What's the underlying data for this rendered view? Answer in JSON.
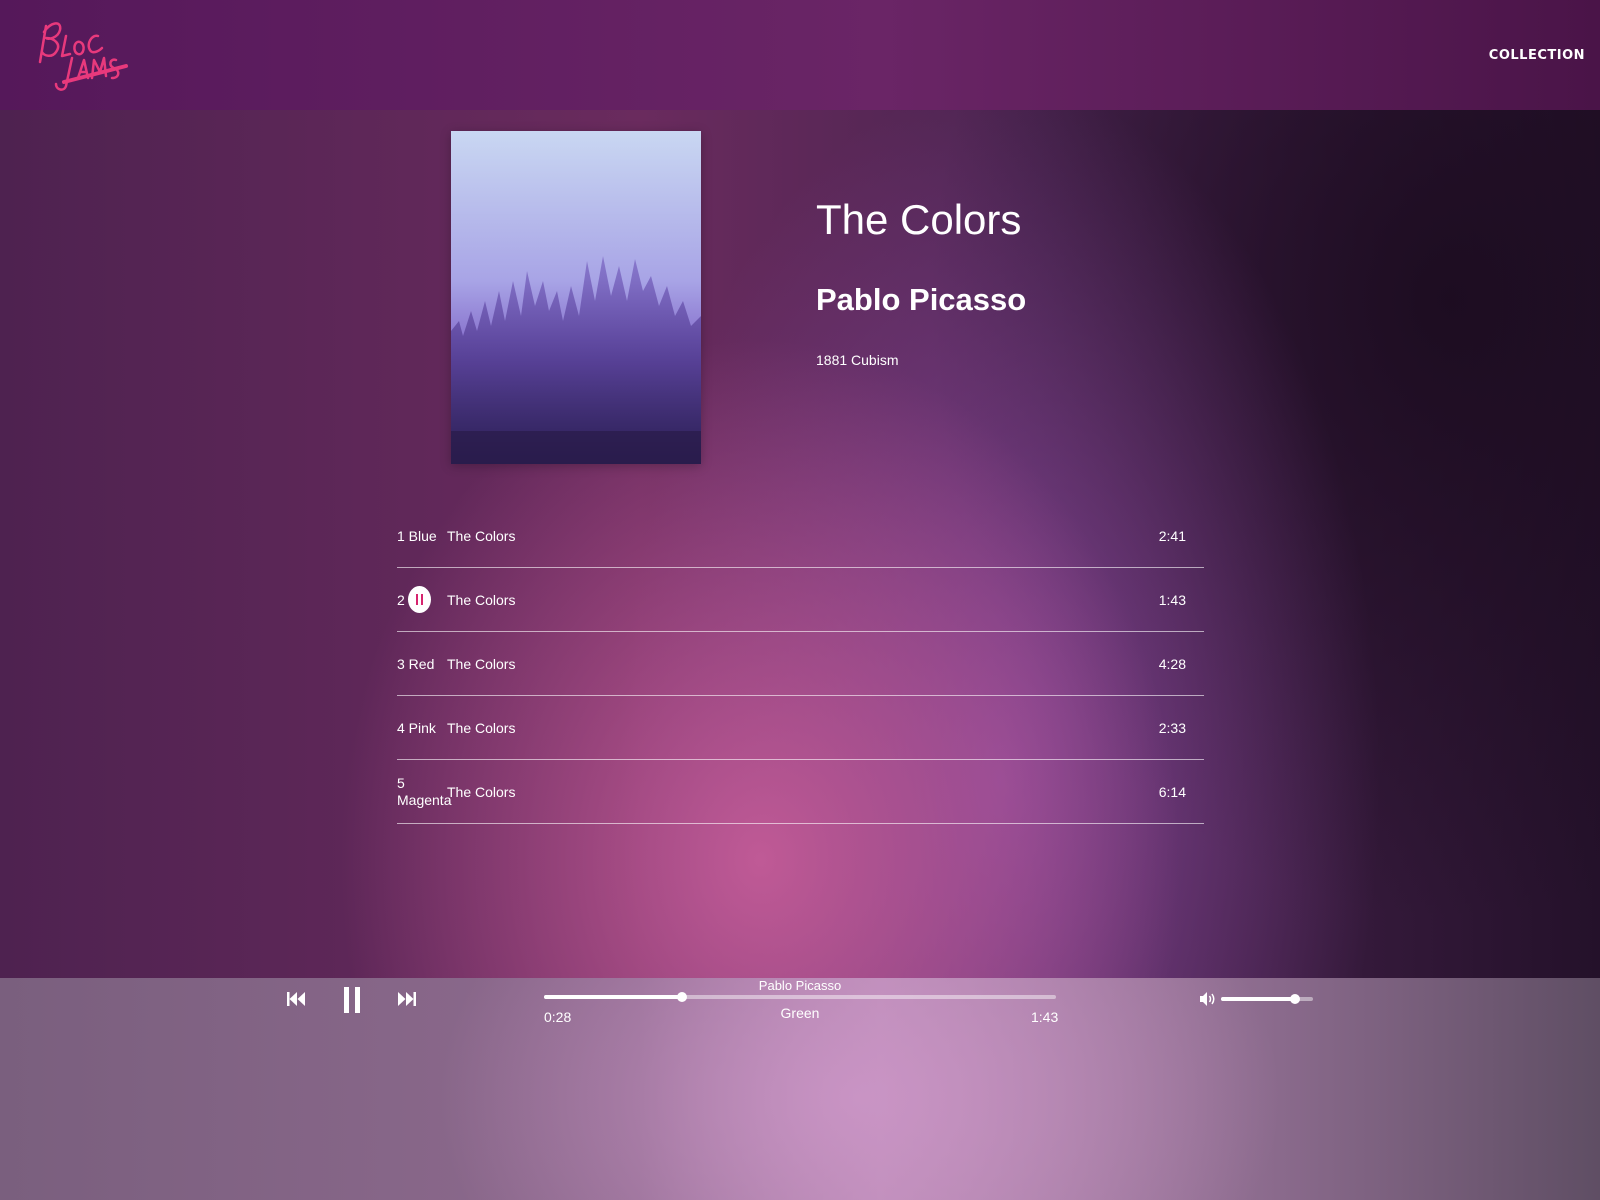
{
  "nav": {
    "logo_text": "Bloc Jams",
    "collection_label": "COLLECTION"
  },
  "album": {
    "title": "The Colors",
    "artist": "Pablo Picasso",
    "release_info": "1881 Cubism"
  },
  "songs": [
    {
      "number": "1",
      "title": "Blue",
      "number_title": "1 Blue",
      "album": "The Colors",
      "duration": "2:41"
    },
    {
      "number": "2",
      "title": "Green",
      "album": "The Colors",
      "duration": "1:43",
      "state": "playing"
    },
    {
      "number": "3",
      "title": "Red",
      "number_title": "3 Red",
      "album": "The Colors",
      "duration": "4:28"
    },
    {
      "number": "4",
      "title": "Pink",
      "number_title": "4 Pink",
      "album": "The Colors",
      "duration": "2:33"
    },
    {
      "number": "5",
      "title": "Magenta",
      "album": "The Colors",
      "duration": "6:14"
    }
  ],
  "player_bar": {
    "now_playing_artist": "Pablo Picasso",
    "now_playing_title": "Green",
    "current_time": "0:28",
    "total_time": "1:43",
    "seek_fraction": 0.27,
    "volume_fraction": 0.8,
    "icons": [
      "previous-icon",
      "pause-icon",
      "next-icon",
      "volume-icon"
    ]
  },
  "colors": {
    "accent": "#d6246e",
    "logo": "#e8397c"
  }
}
